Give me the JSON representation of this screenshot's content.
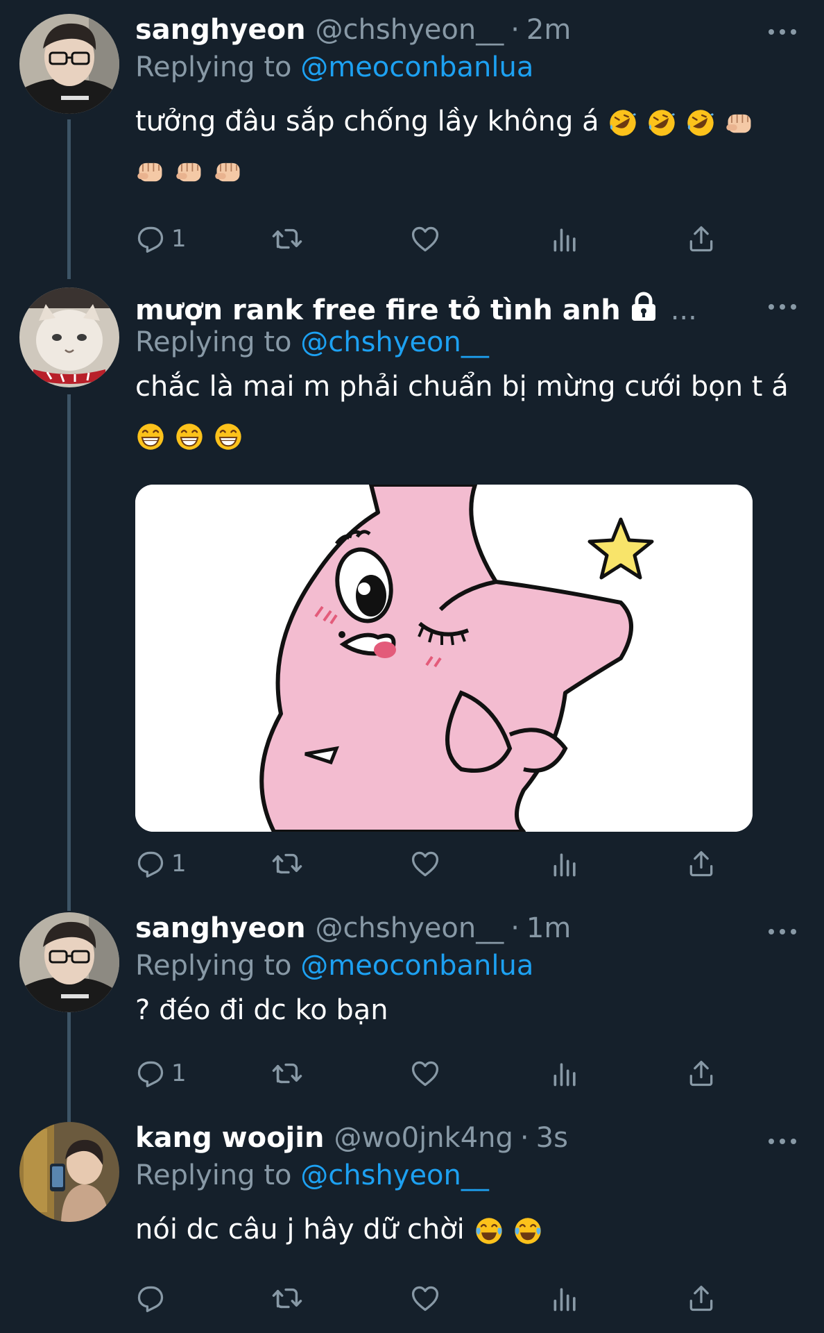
{
  "tweets": [
    {
      "name": "sanghyeon",
      "handle": "@chshyeon__",
      "time": "2m",
      "reply_prefix": "Replying to",
      "reply_to": "@meoconbanlua",
      "text": "tưởng đâu sắp chống lầy không á",
      "reply_count": "1"
    },
    {
      "name": "mượn rank free fire tỏ tình anh",
      "name_suffix": "...",
      "reply_prefix": "Replying to",
      "reply_to": "@chshyeon__",
      "text_line1": "chắc là mai m phải chuẩn bị mừng cưới bọn t á",
      "reply_count": "1"
    },
    {
      "name": "sanghyeon",
      "handle": "@chshyeon__",
      "time": "1m",
      "reply_prefix": "Replying to",
      "reply_to": "@meoconbanlua",
      "text": "? đéo đi dc ko bạn",
      "reply_count": "1"
    },
    {
      "name": "kang woojin",
      "handle": "@wo0jnk4ng",
      "time": "3s",
      "reply_prefix": "Replying to",
      "reply_to": "@chshyeon__",
      "text": "nói dc câu j hây dữ chời"
    }
  ],
  "colors": {
    "background": "#15202b",
    "secondary_text": "#8899a6",
    "mention": "#1da1f2",
    "thread_line": "#3d5466"
  },
  "icons": [
    "reply-icon",
    "retweet-icon",
    "like-icon",
    "analytics-icon",
    "share-icon",
    "more-icon",
    "lock-icon"
  ]
}
